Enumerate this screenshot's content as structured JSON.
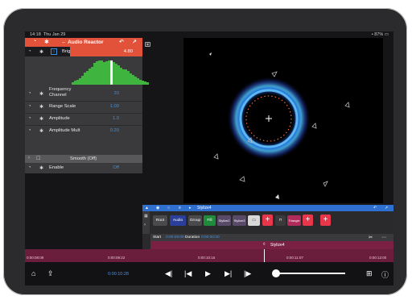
{
  "status": {
    "time": "14:18",
    "date": "Thu Jan 29",
    "battery": "87%"
  },
  "panel": {
    "title": "Audio Reactor",
    "back_glyph": "←",
    "undo_glyph": "↶",
    "close_glyph": "↗",
    "brightness": {
      "label": "Brightness",
      "value": "4.80"
    },
    "params": [
      {
        "label": "Frequency\nChannel",
        "value": "20"
      },
      {
        "label": "Range Scale",
        "value": "1.00"
      },
      {
        "label": "Amplitude",
        "value": "1.0"
      },
      {
        "label": "Amplitude Mult",
        "value": "0.20"
      },
      {
        "label": "Enable",
        "value": "Off"
      }
    ],
    "smooth": "Smooth (Off)",
    "spectrum": [
      3,
      5,
      6,
      8,
      11,
      15,
      17,
      20,
      22,
      27,
      29,
      30,
      30,
      28,
      29,
      30,
      30,
      28,
      26,
      24,
      21,
      19,
      19,
      17,
      14,
      12,
      10,
      8,
      6,
      5,
      4,
      3
    ]
  },
  "editor": {
    "title": "Stylize4",
    "nodes": [
      "Root",
      "Audio",
      "Group",
      "Fill",
      "Stylize2",
      "Stylize3",
      "Triangle"
    ],
    "start_label": "Start",
    "start_value": "0:00:09:00",
    "duration_label": "Duration",
    "duration_value": "0:00:00:00",
    "track_label": "Stylize4"
  },
  "timeline": {
    "ticks": [
      "0:00:08:09",
      "0:00:09:22",
      "0:00:10:15",
      "0:00:11:07",
      "0:00:12:00"
    ]
  },
  "transport": {
    "timecode": "0:00:10:28"
  }
}
